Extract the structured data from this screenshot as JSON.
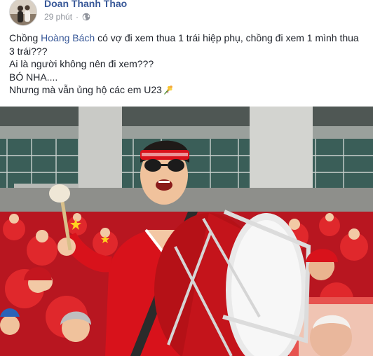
{
  "post": {
    "author": "Doan Thanh Thao",
    "time": "29 phút",
    "separator": "·",
    "privacy_icon": "globe-icon",
    "lines": {
      "l1_pre": "Chồng ",
      "l1_mention": "Hoàng Bách",
      "l1_post": " có vợ đi xem thua 1 trái hiệp phụ, chồng đi xem 1 mình thua 3 trái???",
      "l2": "Ai là người không nên đi xem???",
      "l3": "BÓ NHA....",
      "l4": "Nhưng mà vẫn ủng hộ các em U23"
    },
    "emoji_icon": "flower-bouquet-icon",
    "photo_icon": "stadium-drummer-photo"
  },
  "colors": {
    "link": "#385898",
    "text": "#1d2129",
    "meta": "#90949c",
    "jersey_red": "#d8121b",
    "stadium_teal": "#2f5a54"
  }
}
